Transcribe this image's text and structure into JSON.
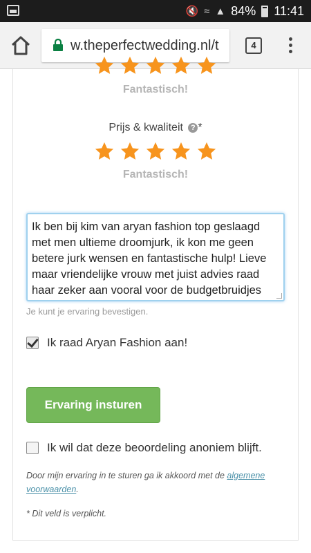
{
  "status_bar": {
    "battery_percent": "84%",
    "time": "11:41"
  },
  "browser": {
    "url": "w.theperfectwedding.nl/t",
    "tab_count": "4"
  },
  "colors": {
    "star": "#f7941d",
    "accent_button": "#75b85a",
    "link": "#4a90a8"
  },
  "ratings": [
    {
      "label": "",
      "stars": 5,
      "max_stars": 5,
      "word": "Fantastisch!"
    },
    {
      "label": "Prijs & kwaliteit",
      "required_mark": "*",
      "stars": 5,
      "max_stars": 5,
      "word": "Fantastisch!"
    }
  ],
  "review": {
    "text": "Ik ben bij kim van aryan fashion top geslaagd met men ultieme droomjurk, ik kon me geen betere jurk wensen en fantastische hulp! Lieve maar vriendelijke vrouw met juist advies raad haar zeker aan vooral voor de budgetbruidjes",
    "hint": "Je kunt je ervaring bevestigen."
  },
  "recommend": {
    "label": "Ik raad Aryan Fashion aan!",
    "checked": true
  },
  "submit_label": "Ervaring insturen",
  "anonymous": {
    "label": "Ik wil dat deze beoordeling anoniem blijft.",
    "checked": false
  },
  "terms": {
    "prefix": "Door mijn ervaring in te sturen ga ik akkoord met de ",
    "link_text": "algemene voorwaarden",
    "suffix": "."
  },
  "required_note": "* Dit veld is verplicht."
}
